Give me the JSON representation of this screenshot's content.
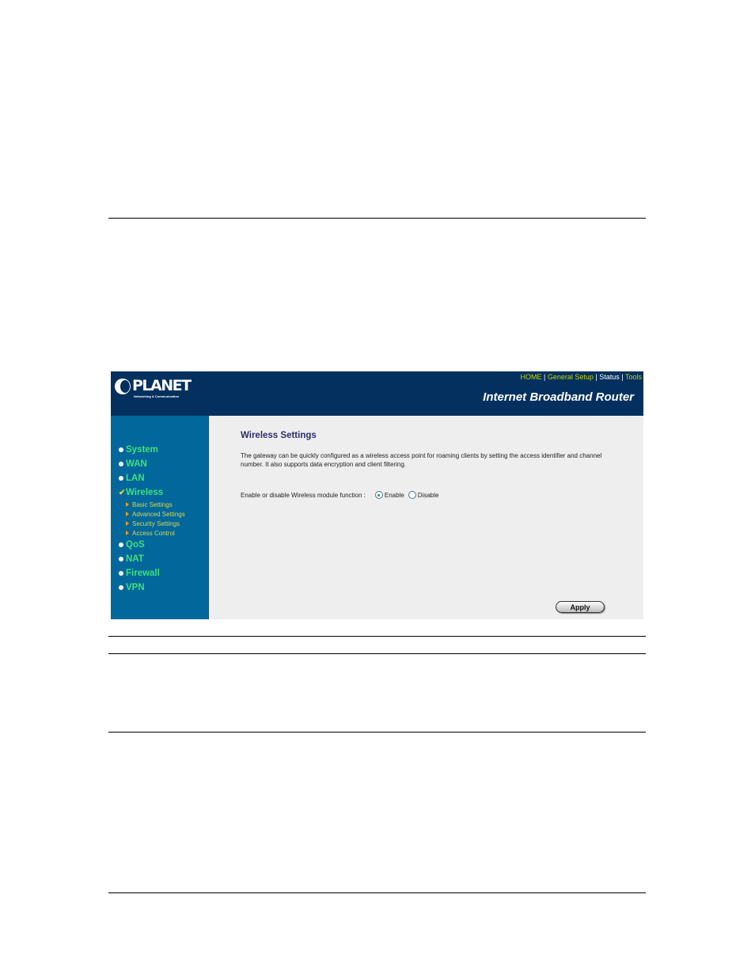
{
  "router": {
    "brand": {
      "name": "PLANET",
      "tagline": "Networking & Communication"
    },
    "top_links": [
      {
        "label": "HOME"
      },
      {
        "label": "General Setup"
      },
      {
        "label": "Status"
      },
      {
        "label": "Tools"
      }
    ],
    "title": "Internet Broadband Router",
    "sidebar": {
      "items": [
        {
          "label": "System",
          "icon": "bullet-icon"
        },
        {
          "label": "WAN",
          "icon": "bullet-icon"
        },
        {
          "label": "LAN",
          "icon": "bullet-icon"
        },
        {
          "label": "Wireless",
          "icon": "checkmark-icon",
          "active": true,
          "children": [
            {
              "label": "Basic Settings"
            },
            {
              "label": "Advanced Settings"
            },
            {
              "label": "Security Settings"
            },
            {
              "label": "Access Control"
            }
          ]
        },
        {
          "label": "QoS",
          "icon": "bullet-icon"
        },
        {
          "label": "NAT",
          "icon": "bullet-icon"
        },
        {
          "label": "Firewall",
          "icon": "bullet-icon"
        },
        {
          "label": "VPN",
          "icon": "bullet-icon"
        }
      ]
    },
    "content": {
      "title": "Wireless Settings",
      "description": "The gateway can be quickly configured as a wireless access point for roaming clients by setting the access identifier and channel number. It also supports data encryption and client filtering.",
      "wireless_function": {
        "label": "Enable or disable Wireless module function :",
        "options": [
          {
            "label": "Enable",
            "selected": true
          },
          {
            "label": "Disable",
            "selected": false
          }
        ]
      },
      "apply_label": "Apply"
    },
    "colors": {
      "header_bg": "#03305f",
      "sidebar_bg": "#02679b",
      "content_bg": "#eeeeee",
      "nav_text": "#3fe27a",
      "subnav_text": "#d8d84a",
      "link_text": "#c8d400",
      "title_text": "#2c2c6c"
    }
  }
}
